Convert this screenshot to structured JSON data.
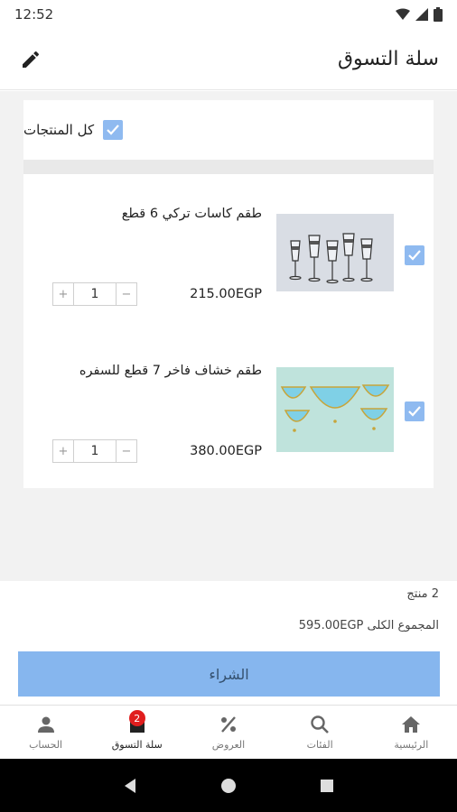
{
  "status": {
    "time": "12:52"
  },
  "header": {
    "title": "سلة التسوق"
  },
  "cart": {
    "select_all_label": "كل المنتجات",
    "items": [
      {
        "name": "طقم كاسات تركي 6 قطع",
        "price": "215.00EGP",
        "quantity": "1",
        "checked": true
      },
      {
        "name": "طقم خشاف فاخر 7 قطع للسفره",
        "price": "380.00EGP",
        "quantity": "1",
        "checked": true
      }
    ],
    "stepper": {
      "plus": "+",
      "minus": "−"
    }
  },
  "summary": {
    "count_text": "2 منتج",
    "total_text": "المجموع الكلى 595.00EGP"
  },
  "buy_label": "الشراء",
  "nav": {
    "items": [
      {
        "label": "الحساب",
        "icon": "person-icon"
      },
      {
        "label": "سلة التسوق",
        "icon": "shopping-bag-icon",
        "badge": "2",
        "active": true
      },
      {
        "label": "العروض",
        "icon": "percent-icon"
      },
      {
        "label": "الفئات",
        "icon": "search-icon"
      },
      {
        "label": "الرئيسية",
        "icon": "home-icon"
      }
    ]
  },
  "colors": {
    "accent": "#86b6ee",
    "checkbox": "#8fbaf0",
    "badge": "#e01e1e"
  }
}
